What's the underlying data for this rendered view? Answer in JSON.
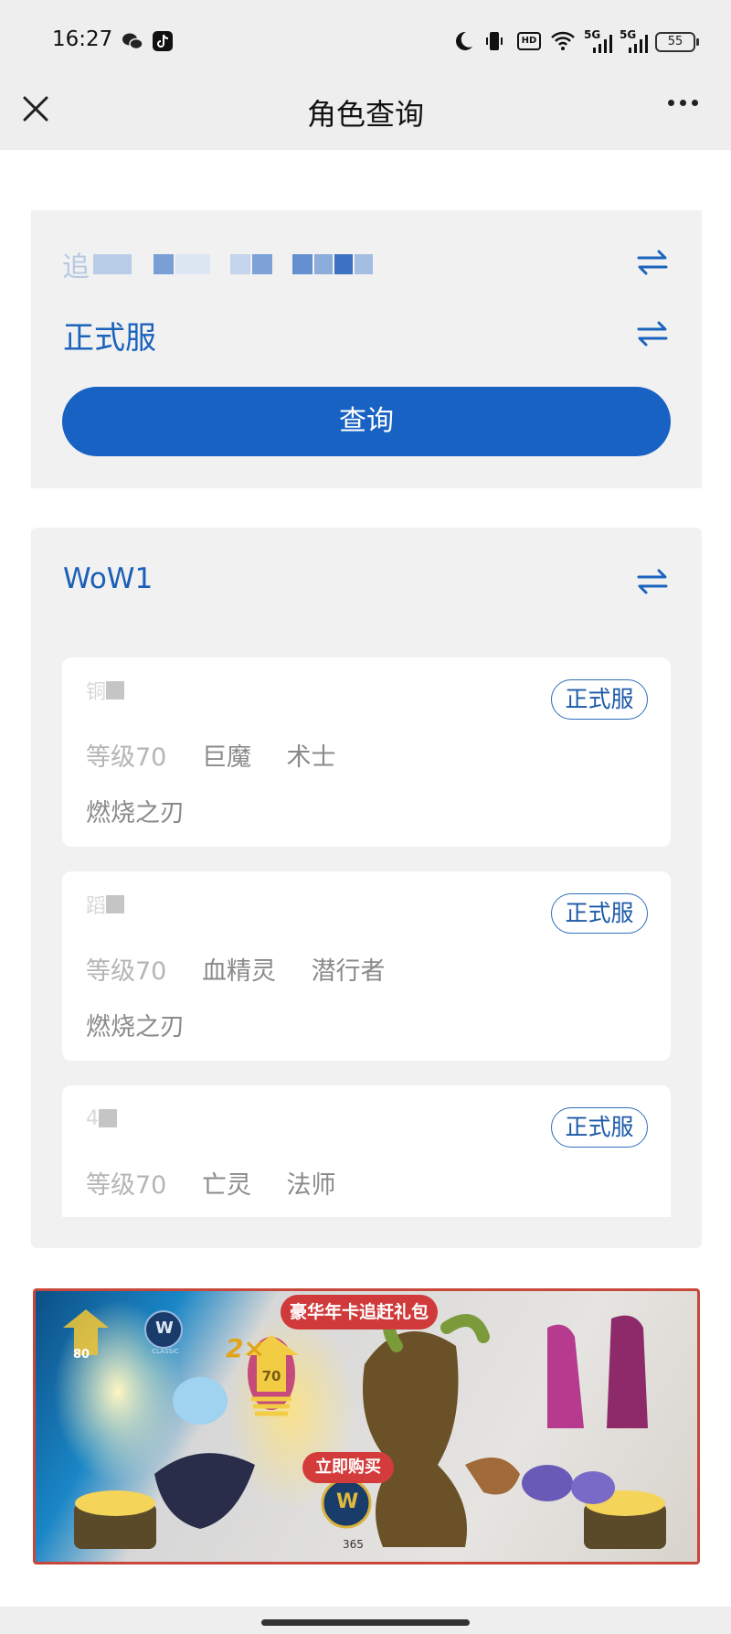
{
  "status_bar": {
    "time": "16:27",
    "network_1": "5G",
    "network_2": "5G",
    "battery": "55",
    "hd_label": "HD"
  },
  "header": {
    "title": "角色查询"
  },
  "query_panel": {
    "realm_partial": "追",
    "server_type": "正式服",
    "query_button": "查询"
  },
  "account": {
    "name": "WoW1"
  },
  "characters": [
    {
      "name_partial": "铜",
      "badge": "正式服",
      "level": "等级70",
      "race": "巨魔",
      "class": "术士",
      "realm": "燃烧之刃"
    },
    {
      "name_partial": "蹈",
      "badge": "正式服",
      "level": "等级70",
      "race": "血精灵",
      "class": "潜行者",
      "realm": "燃烧之刃"
    },
    {
      "name_partial": "4",
      "badge": "正式服",
      "level": "等级70",
      "race": "亡灵",
      "class": "法师"
    }
  ],
  "banner": {
    "tag": "豪华年卡追赶礼包",
    "buy_button": "立即购买",
    "multiplier": "2×",
    "level_left": "80",
    "level_mid": "70",
    "logo_sub": "CLASSIC",
    "year_label": "365"
  },
  "colors": {
    "accent": "#1862c4",
    "panel_bg": "#f1f1f1",
    "banner_red": "#d03a3a"
  }
}
